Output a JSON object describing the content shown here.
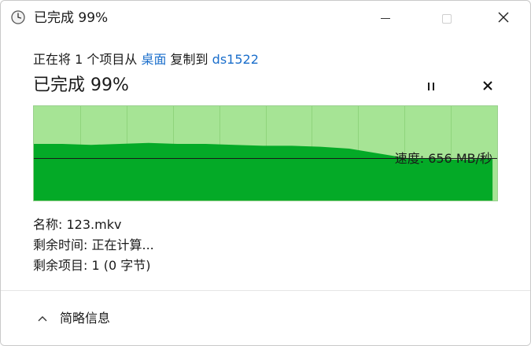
{
  "window": {
    "title": "已完成 99%"
  },
  "copy": {
    "prefix": "正在将 1 个项目从 ",
    "source": "桌面",
    "middle": " 复制到 ",
    "destination": "ds1522"
  },
  "progress": {
    "title": "已完成 99%",
    "percent": 99
  },
  "graph": {
    "speed_label": "速度: 656 MB/秒",
    "colors": {
      "fill_dark": "#04aa27",
      "fill_light": "#a6e495",
      "grid": "#8fd47c",
      "current_line": "#1a1a1a"
    },
    "throughput_profile": [
      0.6,
      0.6,
      0.59,
      0.6,
      0.61,
      0.6,
      0.6,
      0.59,
      0.58,
      0.58,
      0.57,
      0.55,
      0.5,
      0.45,
      0.44,
      0.43,
      0.45
    ]
  },
  "details": {
    "name_label": "名称:",
    "name_value": "123.mkv",
    "remaining_time_label": "剩余时间:",
    "remaining_time_value": "正在计算...",
    "remaining_items_label": "剩余项目:",
    "remaining_items_value": "1 (0 字节)"
  },
  "footer": {
    "collapse_label": "简略信息"
  },
  "icons": {
    "app": "clock-icon",
    "pause": "pause-icon",
    "cancel": "close-icon",
    "collapse": "chevron-up-icon"
  }
}
